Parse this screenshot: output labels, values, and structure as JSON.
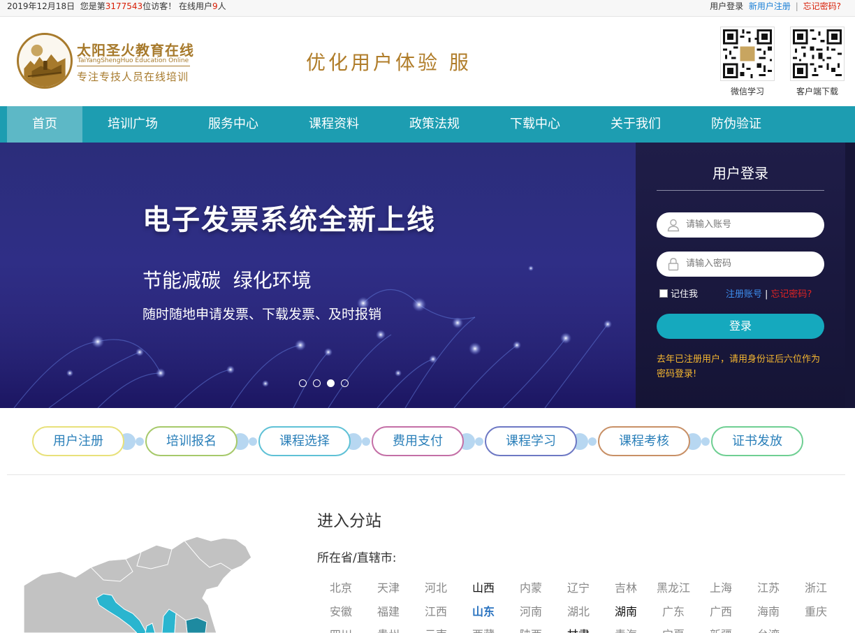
{
  "topbar": {
    "date": "2019年12月18日",
    "visitor_prefix": "您是第",
    "visitor_count": "3177543",
    "visitor_suffix": "位访客！ 在线用户",
    "online_count": "9",
    "online_suffix": "人",
    "login": "用户登录",
    "register": "新用户注册",
    "separator": "|",
    "forgot": "忘记密码?"
  },
  "header": {
    "logo_title": "太阳圣火教育在线",
    "logo_en": "TaiYangShengHuo Education Online",
    "logo_sub": "专注专技人员在线培训",
    "slogan": "优化用户体验 服",
    "qr": [
      {
        "caption": "微信学习"
      },
      {
        "caption": "客户端下载"
      }
    ]
  },
  "nav": [
    {
      "label": "首页",
      "active": true
    },
    {
      "label": "培训广场"
    },
    {
      "label": "服务中心"
    },
    {
      "label": "课程资料"
    },
    {
      "label": "政策法规"
    },
    {
      "label": "下载中心"
    },
    {
      "label": "关于我们"
    },
    {
      "label": "防伪验证"
    }
  ],
  "banner": {
    "title": "电子发票系统全新上线",
    "subtitle": "节能减碳  绿化环境",
    "description": "随时随地申请发票、下载发票、及时报销",
    "slide_count": 4,
    "active_slide": 3
  },
  "login_panel": {
    "title": "用户登录",
    "account_placeholder": "请输入账号",
    "password_placeholder": "请输入密码",
    "remember": "记住我",
    "register": "注册账号",
    "separator": "|",
    "forgot": "忘记密码?",
    "submit": "登录",
    "tip": "去年已注册用户，请用身份证后六位作为密码登录!"
  },
  "steps": [
    {
      "label": "用户注册",
      "color": "#e8e17a"
    },
    {
      "label": "培训报名",
      "color": "#a6c96a"
    },
    {
      "label": "课程选择",
      "color": "#5fc1d6"
    },
    {
      "label": "费用支付",
      "color": "#c46fa6"
    },
    {
      "label": "课程学习",
      "color": "#6d78c4"
    },
    {
      "label": "课程考核",
      "color": "#c89066"
    },
    {
      "label": "证书发放",
      "color": "#6fcf93"
    }
  ],
  "substation": {
    "title": "进入分站",
    "label": "所在省/直辖市:",
    "provinces": [
      {
        "name": "北京"
      },
      {
        "name": "天津"
      },
      {
        "name": "河北"
      },
      {
        "name": "山西",
        "style": "dark"
      },
      {
        "name": "内蒙"
      },
      {
        "name": "辽宁"
      },
      {
        "name": "吉林"
      },
      {
        "name": "黑龙江"
      },
      {
        "name": "上海"
      },
      {
        "name": "江苏"
      },
      {
        "name": "浙江"
      },
      {
        "name": "安徽"
      },
      {
        "name": "福建"
      },
      {
        "name": "江西"
      },
      {
        "name": "山东",
        "style": "blue"
      },
      {
        "name": "河南"
      },
      {
        "name": "湖北"
      },
      {
        "name": "湖南",
        "style": "dark"
      },
      {
        "name": "广东"
      },
      {
        "name": "广西"
      },
      {
        "name": "海南"
      },
      {
        "name": "重庆"
      },
      {
        "name": "四川"
      },
      {
        "name": "贵州"
      },
      {
        "name": "云南"
      },
      {
        "name": "西藏"
      },
      {
        "name": "陕西"
      },
      {
        "name": "甘肃",
        "style": "dark"
      },
      {
        "name": "青海"
      },
      {
        "name": "宁夏"
      },
      {
        "name": "新疆"
      },
      {
        "name": "台湾"
      }
    ]
  },
  "colors": {
    "brand_gold": "#a77a2c",
    "nav_bg": "#1d9db1",
    "nav_active": "#5db8c6",
    "login_button": "#15a9be",
    "highlight_red": "#d81e06"
  }
}
